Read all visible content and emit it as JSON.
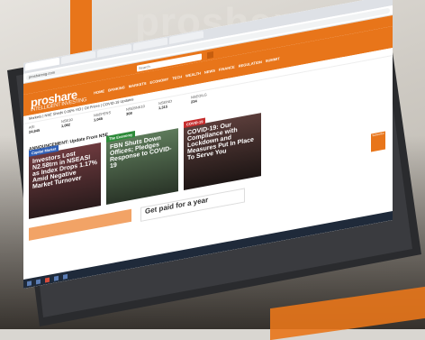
{
  "background": {
    "sign_text": "proshare",
    "brand_color": "#e8751a"
  },
  "browser": {
    "url": "proshareng.com",
    "tabs": [
      "",
      "",
      "",
      "",
      "",
      ""
    ]
  },
  "site": {
    "search_placeholder": "Search",
    "logo": "proshare",
    "logo_tagline": "INTELLIGENT INVESTING",
    "nav": [
      "HOME",
      "BANKING",
      "MARKETS",
      "ECONOMY",
      "TECH",
      "WEALTH",
      "NEWS",
      "FINANCE",
      "REGULATION",
      "SUMMIT"
    ],
    "ticker": "Markets | NSE Sheds 0.06% YtD | Oil Prices | COVID-19 Updates",
    "market": [
      {
        "label": "ASI",
        "value": "24,845"
      },
      {
        "label": "NSE30",
        "value": "1,062"
      },
      {
        "label": "NSEPENS",
        "value": "1,045"
      },
      {
        "label": "NSEBNK10",
        "value": "308"
      },
      {
        "label": "NSEIND",
        "value": "1,315"
      },
      {
        "label": "NSEOILG",
        "value": "234"
      }
    ],
    "headline": "ANNOUNCEMENT: Update From NSE",
    "cards": [
      {
        "tag": "Capital Market",
        "tag_color": "#2f5fb5",
        "title": "Investors Lost N2.58trn in NSEASI as Index Drops 1.17% Amid Negative Market Turnover"
      },
      {
        "tag": "The Economy",
        "tag_color": "#2e8b3a",
        "title": "FBN Shuts Down Offices; Pledges Response to COVID-19"
      },
      {
        "tag": "COVID-19",
        "tag_color": "#c62f2f",
        "title": "COVID-19: Our Compliance with Lockdown and Measures Put In Place To Serve You"
      }
    ],
    "ads": [
      {
        "text": ""
      },
      {
        "text": "Get paid for a year"
      }
    ],
    "float_button": "Subscribe"
  }
}
